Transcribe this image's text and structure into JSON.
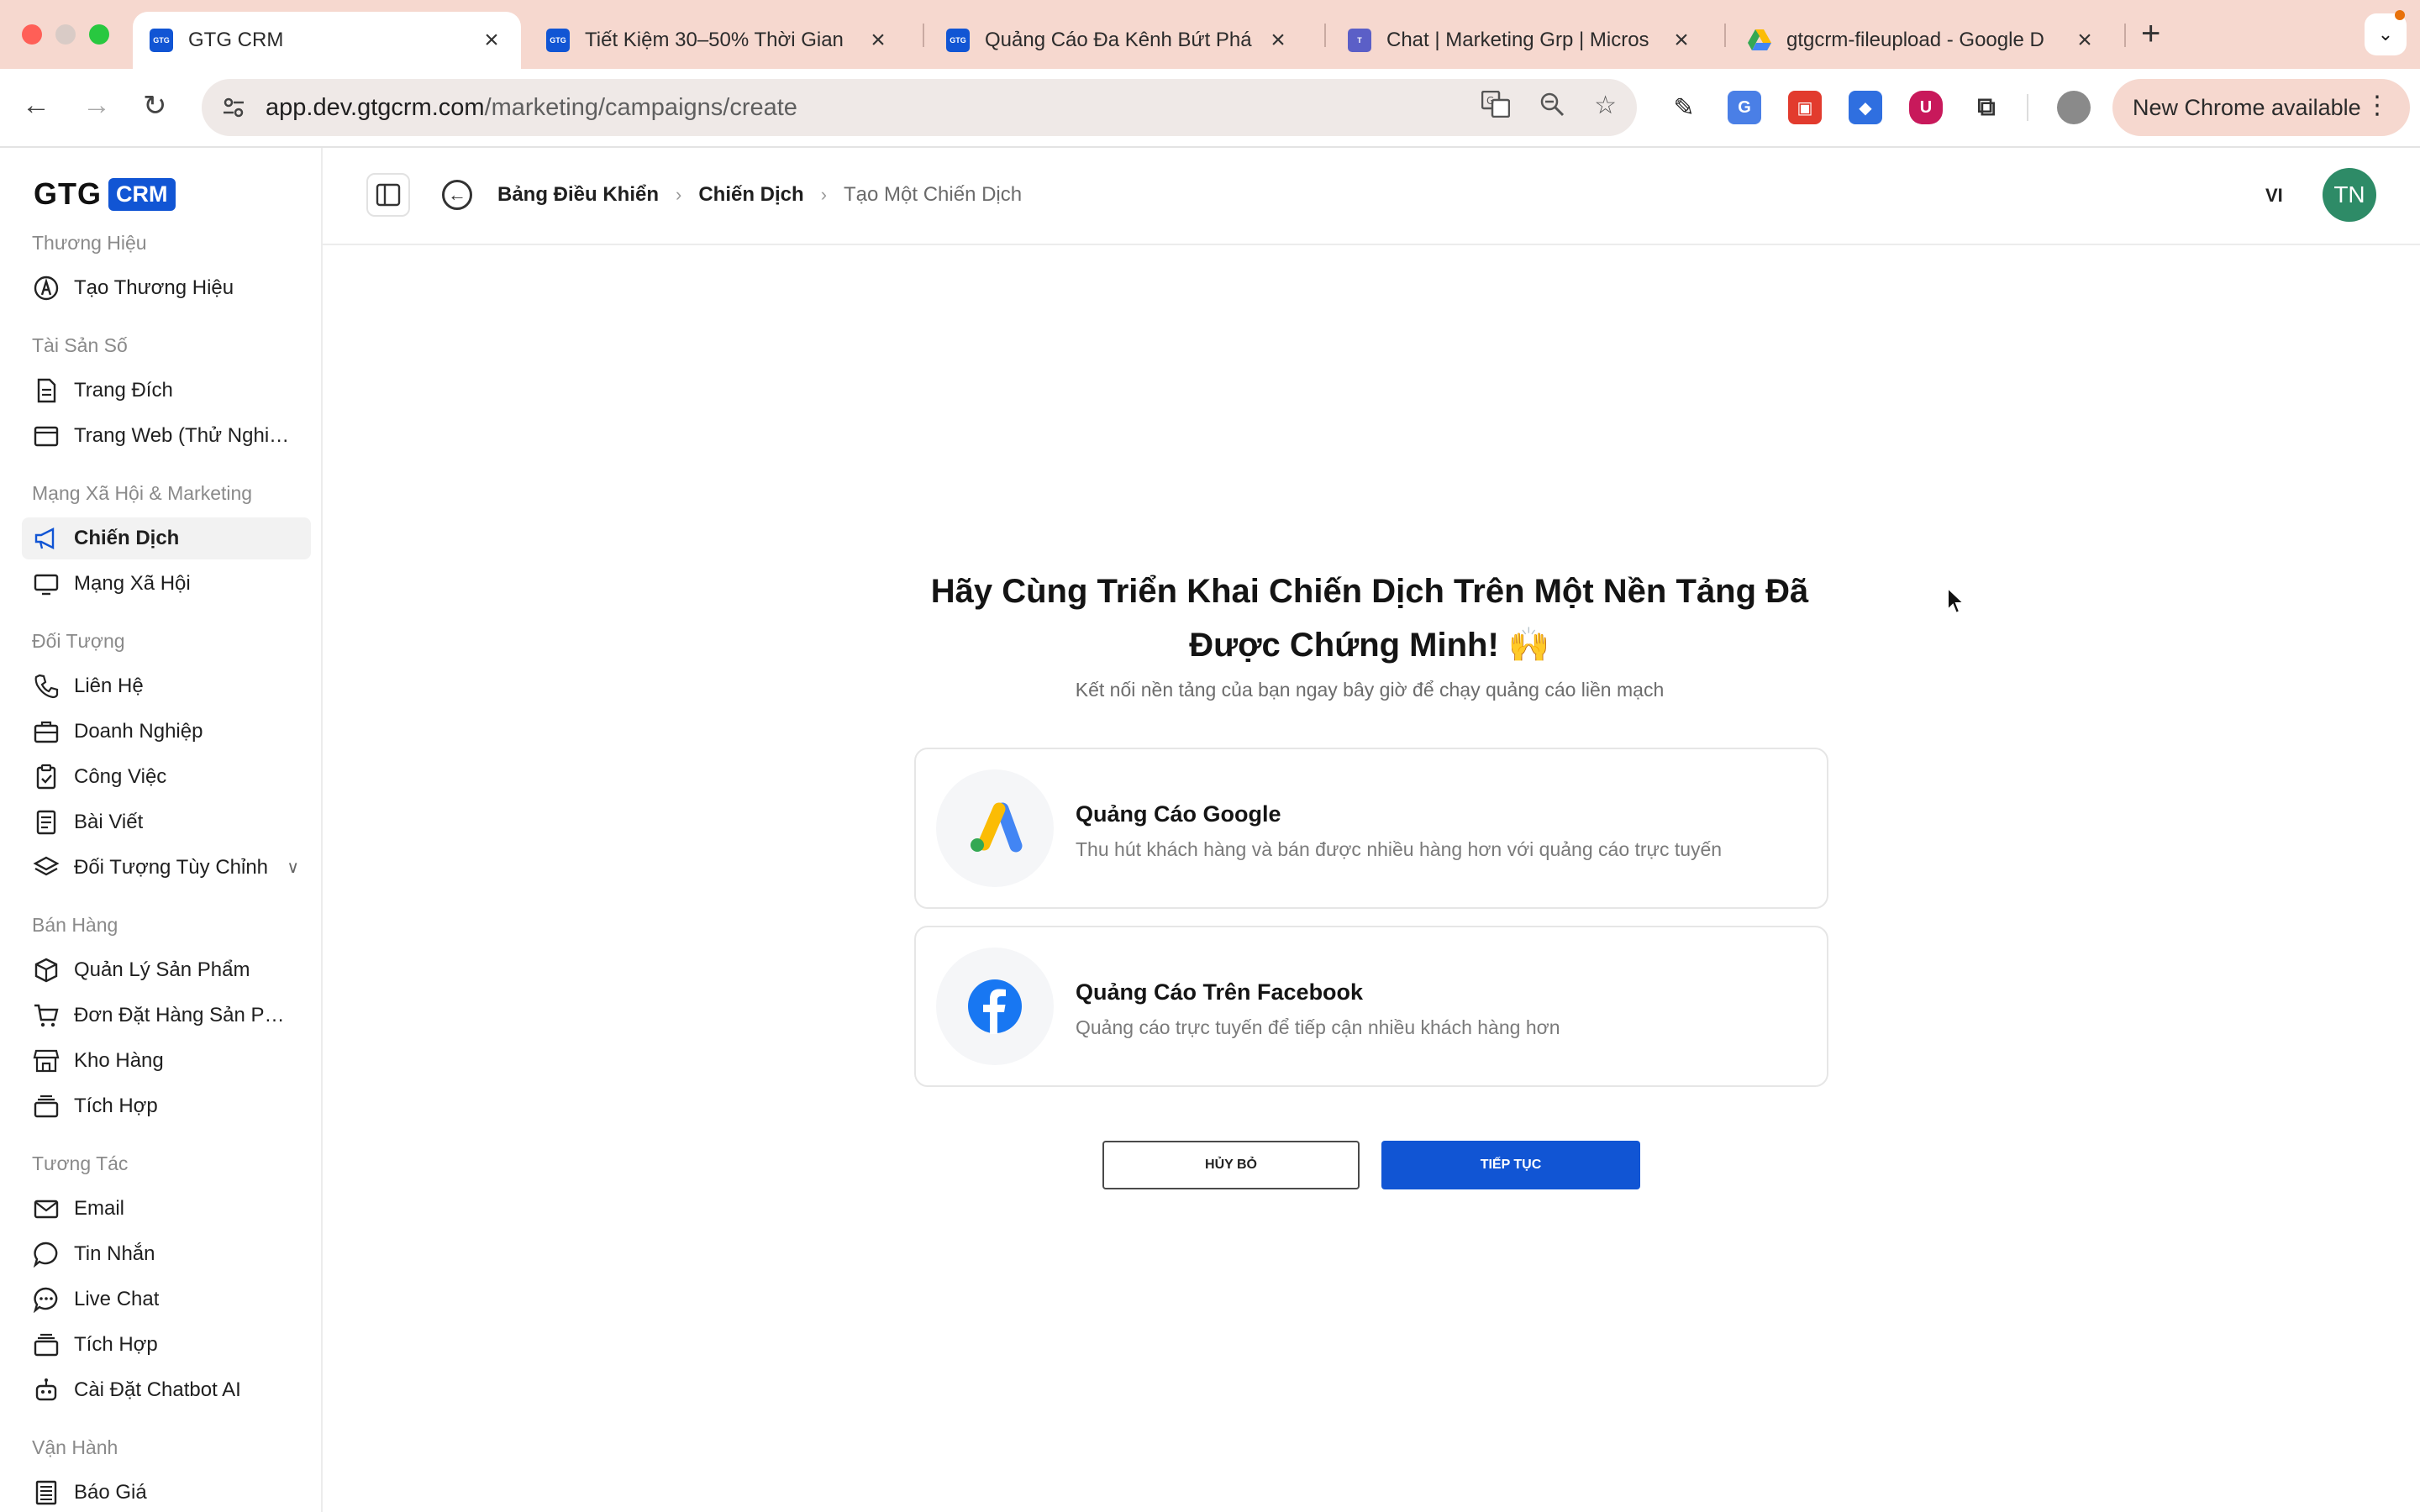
{
  "browser": {
    "tabs": [
      {
        "title": "GTG CRM",
        "favicon": "gtg-crm-favicon",
        "active": true
      },
      {
        "title": "Tiết Kiệm 30–50% Thời Gian",
        "favicon": "gtg-crm-favicon",
        "active": false
      },
      {
        "title": "Quảng Cáo Đa Kênh Bứt Phá",
        "favicon": "gtg-crm-favicon",
        "active": false
      },
      {
        "title": "Chat | Marketing Grp | Micros",
        "favicon": "teams-icon",
        "active": false
      },
      {
        "title": "gtgcrm-fileupload - Google D",
        "favicon": "google-drive-icon",
        "active": false
      }
    ],
    "url_host": "app.dev.gtgcrm.com",
    "url_path": "/marketing/campaigns/create",
    "new_chrome_label": "New Chrome available"
  },
  "app": {
    "logo_text": "GTG",
    "logo_badge": "CRM",
    "brand_color": "#1155d4"
  },
  "sidebar": {
    "sections": [
      {
        "title": "Thương Hiệu",
        "items": [
          {
            "label": "Tạo Thương Hiệu",
            "icon": "brand-pen-icon"
          }
        ]
      },
      {
        "title": "Tài Sản Số",
        "items": [
          {
            "label": "Trang Đích",
            "icon": "document-icon"
          },
          {
            "label": "Trang Web (Thử Nghiệ...",
            "icon": "browser-window-icon"
          }
        ]
      },
      {
        "title": "Mạng Xã Hội & Marketing",
        "items": [
          {
            "label": "Chiến Dịch",
            "icon": "megaphone-icon",
            "active": true
          },
          {
            "label": "Mạng Xã Hội",
            "icon": "monitor-icon"
          }
        ]
      },
      {
        "title": "Đối Tượng",
        "items": [
          {
            "label": "Liên Hệ",
            "icon": "phone-icon"
          },
          {
            "label": "Doanh Nghiệp",
            "icon": "briefcase-icon"
          },
          {
            "label": "Công Việc",
            "icon": "clipboard-check-icon"
          },
          {
            "label": "Bài Viết",
            "icon": "article-icon"
          },
          {
            "label": "Đối Tượng Tùy Chỉnh",
            "icon": "layers-icon",
            "expandable": true
          }
        ]
      },
      {
        "title": "Bán Hàng",
        "items": [
          {
            "label": "Quản Lý Sản Phẩm",
            "icon": "box-icon"
          },
          {
            "label": "Đơn Đặt Hàng Sản Phẩ...",
            "icon": "cart-icon"
          },
          {
            "label": "Kho Hàng",
            "icon": "store-icon"
          },
          {
            "label": "Tích Hợp",
            "icon": "stack-icon"
          }
        ]
      },
      {
        "title": "Tương Tác",
        "items": [
          {
            "label": "Email",
            "icon": "mail-icon"
          },
          {
            "label": "Tin Nhắn",
            "icon": "message-circle-icon"
          },
          {
            "label": "Live Chat",
            "icon": "chat-dots-icon"
          },
          {
            "label": "Tích Hợp",
            "icon": "stack-icon"
          },
          {
            "label": "Cài Đặt Chatbot AI",
            "icon": "bot-icon"
          }
        ]
      },
      {
        "title": "Vận Hành",
        "items": [
          {
            "label": "Báo Giá",
            "icon": "receipt-icon"
          }
        ]
      }
    ]
  },
  "header": {
    "breadcrumbs": [
      "Bảng Điều Khiển",
      "Chiến Dịch",
      "Tạo Một Chiến Dịch"
    ],
    "language": "VI",
    "avatar_initials": "TN",
    "avatar_color": "#2e8b67"
  },
  "main": {
    "title": "Hãy Cùng Triển Khai Chiến Dịch Trên Một Nền Tảng Đã Được Chứng Minh! 🙌",
    "subtitle": "Kết nối nền tảng của bạn ngay bây giờ để chạy quảng cáo liền mạch",
    "platforms": [
      {
        "name": "Quảng Cáo Google",
        "description": "Thu hút khách hàng và bán được nhiều hàng hơn với quảng cáo trực tuyến",
        "icon": "google-ads-icon"
      },
      {
        "name": "Quảng Cáo Trên Facebook",
        "description": "Quảng cáo trực tuyến để tiếp cận nhiều khách hàng hơn",
        "icon": "facebook-icon"
      }
    ],
    "cancel_label": "HỦY BỎ",
    "continue_label": "TIẾP TỤC"
  }
}
